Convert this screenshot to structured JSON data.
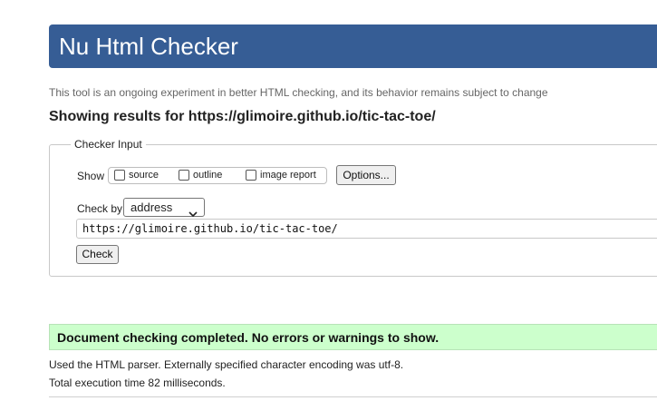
{
  "header": {
    "title": "Nu Html Checker",
    "tagline": "This tool is an ongoing experiment in better HTML checking, and its behavior remains subject to change"
  },
  "results": {
    "heading": "Showing results for https://glimoire.github.io/tic-tac-toe/"
  },
  "checker_input": {
    "legend": "Checker Input",
    "show_label": "Show",
    "show_options": [
      {
        "label": "source",
        "checked": false
      },
      {
        "label": "outline",
        "checked": false
      },
      {
        "label": "image report",
        "checked": false
      }
    ],
    "options_button": "Options...",
    "check_by_label": "Check by",
    "check_by_selected": "address",
    "url_value": "https://glimoire.github.io/tic-tac-toe/",
    "check_button": "Check"
  },
  "status": {
    "success_message": "Document checking completed. No errors or warnings to show.",
    "parser_info": "Used the HTML parser. Externally specified character encoding was utf-8.",
    "execution_time": "Total execution time 82 milliseconds."
  },
  "colors": {
    "header_bg": "#365d95",
    "success_bg": "#ccffcc"
  }
}
